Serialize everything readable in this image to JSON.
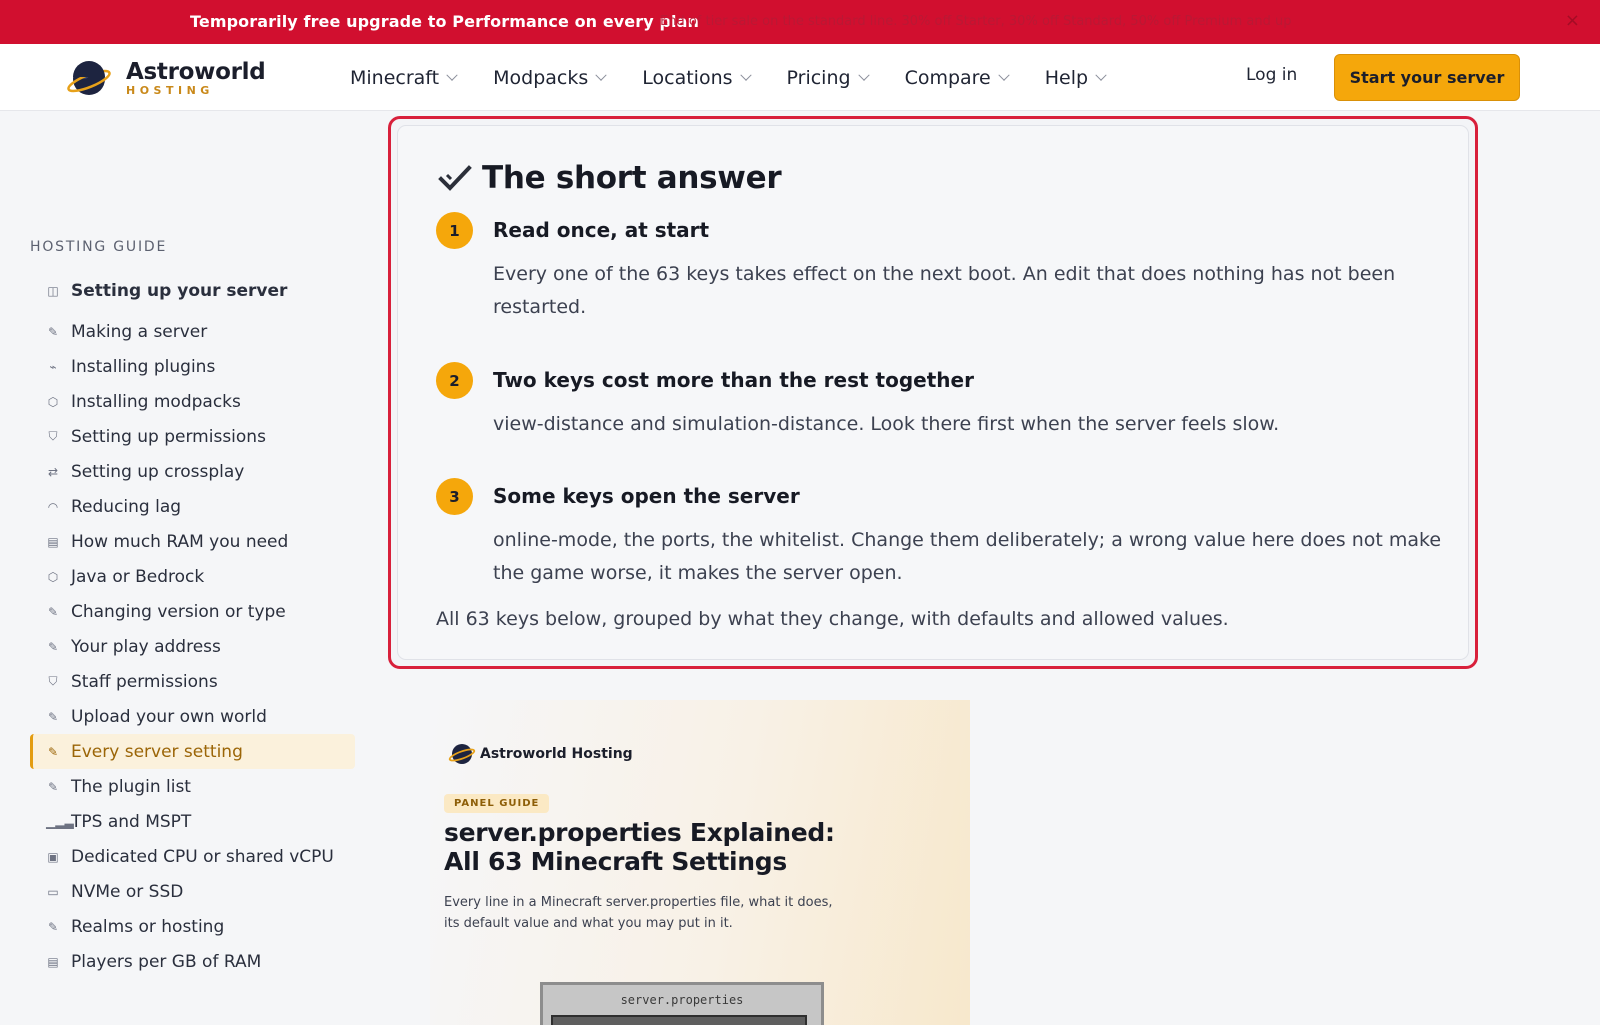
{
  "promo": {
    "headline": "Temporarily free upgrade to Performance on every plan",
    "subtext": "End of tier sale on the standard line. 30% off Starter, 30% off Standard, 50% off Premium and up",
    "close_icon": "×"
  },
  "header": {
    "logo_name": "Astroworld",
    "logo_sub": "HOSTING",
    "nav": [
      {
        "label": "Minecraft"
      },
      {
        "label": "Modpacks"
      },
      {
        "label": "Locations"
      },
      {
        "label": "Pricing"
      },
      {
        "label": "Compare"
      },
      {
        "label": "Help"
      }
    ],
    "login_label": "Log in",
    "cta_label": "Start your server"
  },
  "sidebar": {
    "title": "HOSTING GUIDE",
    "items": [
      {
        "label": "Setting up your server",
        "icon": "book-icon",
        "glyph": "◫"
      },
      {
        "label": "Making a server",
        "icon": "pencil-icon",
        "glyph": "✎"
      },
      {
        "label": "Installing plugins",
        "icon": "plug-icon",
        "glyph": "⌁"
      },
      {
        "label": "Installing modpacks",
        "icon": "cube-icon",
        "glyph": "⬡"
      },
      {
        "label": "Setting up permissions",
        "icon": "shield-icon",
        "glyph": "⛉"
      },
      {
        "label": "Setting up crossplay",
        "icon": "swap-icon",
        "glyph": "⇄"
      },
      {
        "label": "Reducing lag",
        "icon": "gauge-icon",
        "glyph": "◠"
      },
      {
        "label": "How much RAM you need",
        "icon": "ram-icon",
        "glyph": "▤"
      },
      {
        "label": "Java or Bedrock",
        "icon": "cube-icon",
        "glyph": "⬡"
      },
      {
        "label": "Changing version or type",
        "icon": "pencil-icon",
        "glyph": "✎"
      },
      {
        "label": "Your play address",
        "icon": "pencil-icon",
        "glyph": "✎"
      },
      {
        "label": "Staff permissions",
        "icon": "shield-icon",
        "glyph": "⛉"
      },
      {
        "label": "Upload your own world",
        "icon": "pencil-icon",
        "glyph": "✎"
      },
      {
        "label": "Every server setting",
        "icon": "pencil-icon",
        "glyph": "✎"
      },
      {
        "label": "The plugin list",
        "icon": "pencil-icon",
        "glyph": "✎"
      },
      {
        "label": "TPS and MSPT",
        "icon": "bar-chart-icon",
        "glyph": "▁▂▃"
      },
      {
        "label": "Dedicated CPU or shared vCPU",
        "icon": "cpu-icon",
        "glyph": "▣"
      },
      {
        "label": "NVMe or SSD",
        "icon": "drive-icon",
        "glyph": "▭"
      },
      {
        "label": "Realms or hosting",
        "icon": "pencil-icon",
        "glyph": "✎"
      },
      {
        "label": "Players per GB of RAM",
        "icon": "ram-icon",
        "glyph": "▤"
      }
    ],
    "active_index": 13
  },
  "answer": {
    "title": "The short answer",
    "steps": [
      {
        "num": "1",
        "heading": "Read once, at start",
        "body": "Every one of the 63 keys takes effect on the next boot. An edit that does nothing has not been restarted."
      },
      {
        "num": "2",
        "heading": "Two keys cost more than the rest together",
        "body": "view-distance and simulation-distance. Look there first when the server feels slow."
      },
      {
        "num": "3",
        "heading": "Some keys open the server",
        "body": "online-mode, the ports, the whitelist. Change them deliberately; a wrong value here does not make the game worse, it makes the server open."
      }
    ],
    "footer": "All 63 keys below, grouped by what they change, with defaults and allowed values."
  },
  "preview": {
    "brand": "Astroworld Hosting",
    "badge": "PANEL GUIDE",
    "title": "server.properties Explained: All 63 Minecraft Settings",
    "description": "Every line in a Minecraft server.properties file, what it does, its default value and what you may put in it.",
    "window_title": "server.properties"
  },
  "colors": {
    "promo_bg": "#d10f2f",
    "accent": "#f5a70b",
    "highlight_border": "#d8203b",
    "active_bg": "#fbf1dc"
  }
}
